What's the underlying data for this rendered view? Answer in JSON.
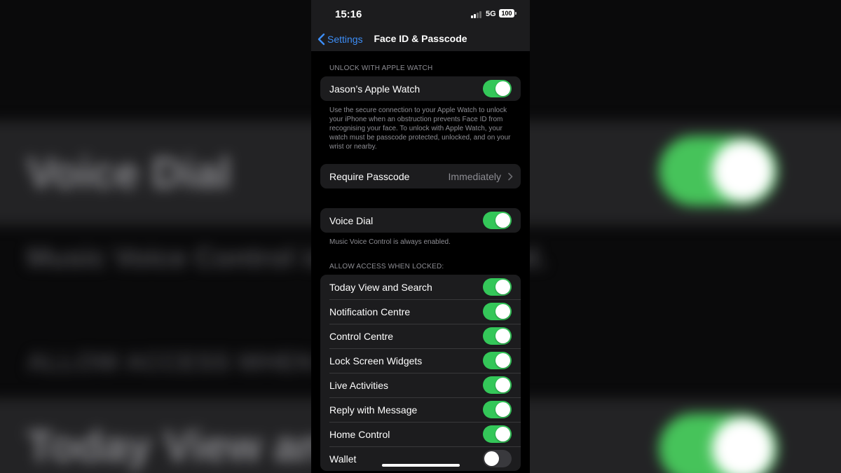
{
  "background": {
    "texts": [
      "Voice Dial",
      "Music Voice Control is always enabled.",
      "ALLOW ACCESS WHEN LOCKED:",
      "Today View and Search"
    ]
  },
  "status_bar": {
    "time": "15:16",
    "network": "5G",
    "battery": "100"
  },
  "nav": {
    "back_label": "Settings",
    "title": "Face ID & Passcode"
  },
  "sections": {
    "apple_watch": {
      "header": "UNLOCK WITH APPLE WATCH",
      "row_label": "Jason’s Apple Watch",
      "toggle_on": true,
      "footer": "Use the secure connection to your Apple Watch to unlock your iPhone when an obstruction prevents Face ID from recognising your face. To unlock with Apple Watch, your watch must be passcode protected, unlocked, and on your wrist or nearby."
    },
    "passcode": {
      "row_label": "Require Passcode",
      "value": "Immediately"
    },
    "voice_dial": {
      "row_label": "Voice Dial",
      "toggle_on": true,
      "footer": "Music Voice Control is always enabled."
    },
    "locked_access": {
      "header": "ALLOW ACCESS WHEN LOCKED:",
      "items": [
        {
          "label": "Today View and Search",
          "on": true
        },
        {
          "label": "Notification Centre",
          "on": true
        },
        {
          "label": "Control Centre",
          "on": true
        },
        {
          "label": "Lock Screen Widgets",
          "on": true
        },
        {
          "label": "Live Activities",
          "on": true
        },
        {
          "label": "Reply with Message",
          "on": true
        },
        {
          "label": "Home Control",
          "on": true
        },
        {
          "label": "Wallet",
          "on": false
        }
      ]
    }
  },
  "colors": {
    "accent": "#3d8ef7",
    "toggle_on": "#34c759",
    "toggle_off": "#39393d",
    "cell": "#1c1c1e",
    "secondary_text": "#8d8d93"
  }
}
